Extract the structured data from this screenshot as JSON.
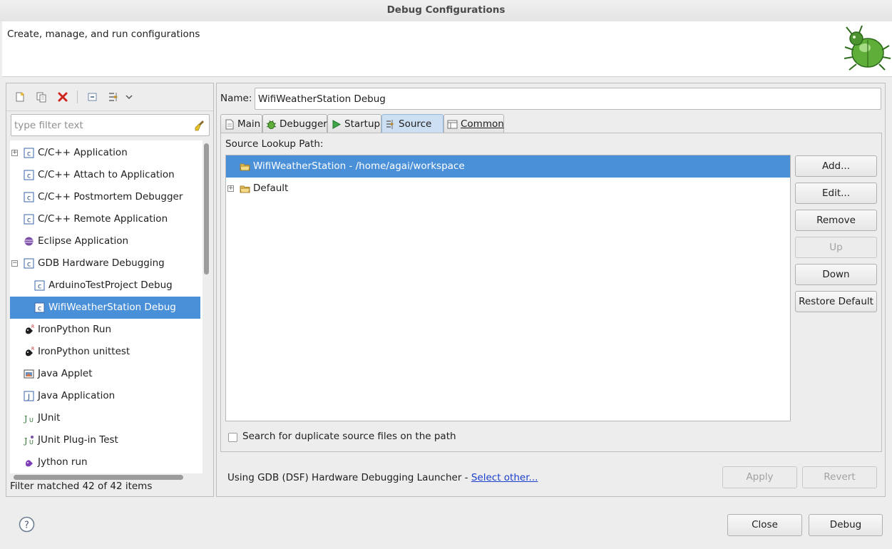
{
  "window": {
    "title": "Debug Configurations"
  },
  "banner": {
    "message": "Create, manage, and run configurations"
  },
  "filter": {
    "placeholder": "type filter text",
    "value": ""
  },
  "tree": {
    "items": [
      {
        "label": "C/C++ Application",
        "level": 0,
        "expander": "+",
        "icon": "c-app-icon"
      },
      {
        "label": "C/C++ Attach to Application",
        "level": 0,
        "icon": "c-app-icon"
      },
      {
        "label": "C/C++ Postmortem Debugger",
        "level": 0,
        "icon": "c-app-icon"
      },
      {
        "label": "C/C++ Remote Application",
        "level": 0,
        "icon": "c-app-icon"
      },
      {
        "label": "Eclipse Application",
        "level": 0,
        "icon": "eclipse-icon"
      },
      {
        "label": "GDB Hardware Debugging",
        "level": 0,
        "expander": "−",
        "icon": "c-app-icon"
      },
      {
        "label": "ArduinoTestProject Debug",
        "level": 1,
        "icon": "c-app-icon"
      },
      {
        "label": "WifiWeatherStation Debug",
        "level": 1,
        "icon": "c-app-icon",
        "selected": true
      },
      {
        "label": "IronPython Run",
        "level": 0,
        "icon": "python-icon"
      },
      {
        "label": "IronPython unittest",
        "level": 0,
        "icon": "python-icon"
      },
      {
        "label": "Java Applet",
        "level": 0,
        "icon": "java-applet-icon"
      },
      {
        "label": "Java Application",
        "level": 0,
        "icon": "java-app-icon"
      },
      {
        "label": "JUnit",
        "level": 0,
        "icon": "junit-icon"
      },
      {
        "label": "JUnit Plug-in Test",
        "level": 0,
        "icon": "junit-plugin-icon"
      },
      {
        "label": "Jython run",
        "level": 0,
        "icon": "jython-icon"
      }
    ]
  },
  "filter_status": "Filter matched 42 of 42 items",
  "config": {
    "name_label": "Name:",
    "name_value": "WifiWeatherStation Debug"
  },
  "tabs": [
    {
      "label": "Main",
      "icon": "main-tab-icon"
    },
    {
      "label": "Debugger",
      "icon": "debugger-tab-icon"
    },
    {
      "label": "Startup",
      "icon": "startup-tab-icon"
    },
    {
      "label": "Source",
      "icon": "source-tab-icon",
      "active": true
    },
    {
      "label": "Common",
      "icon": "common-tab-icon"
    }
  ],
  "source": {
    "lookup_label": "Source Lookup Path:",
    "entries": [
      {
        "label": "WifiWeatherStation - /home/agai/workspace",
        "selected": true
      },
      {
        "label": "Default",
        "expander": "+"
      }
    ],
    "buttons": {
      "add": "Add...",
      "edit": "Edit...",
      "remove": "Remove",
      "up": "Up",
      "down": "Down",
      "restore": "Restore Default"
    },
    "duplicate_checkbox": "Search for duplicate source files on the path"
  },
  "launcher": {
    "text": "Using GDB (DSF) Hardware Debugging Launcher - ",
    "link": "Select other..."
  },
  "actions": {
    "apply": "Apply",
    "revert": "Revert",
    "close": "Close",
    "debug": "Debug"
  },
  "colors": {
    "selection": "#4a90d9",
    "active_tab": "#ccdff3",
    "link": "#1a3fcc"
  }
}
